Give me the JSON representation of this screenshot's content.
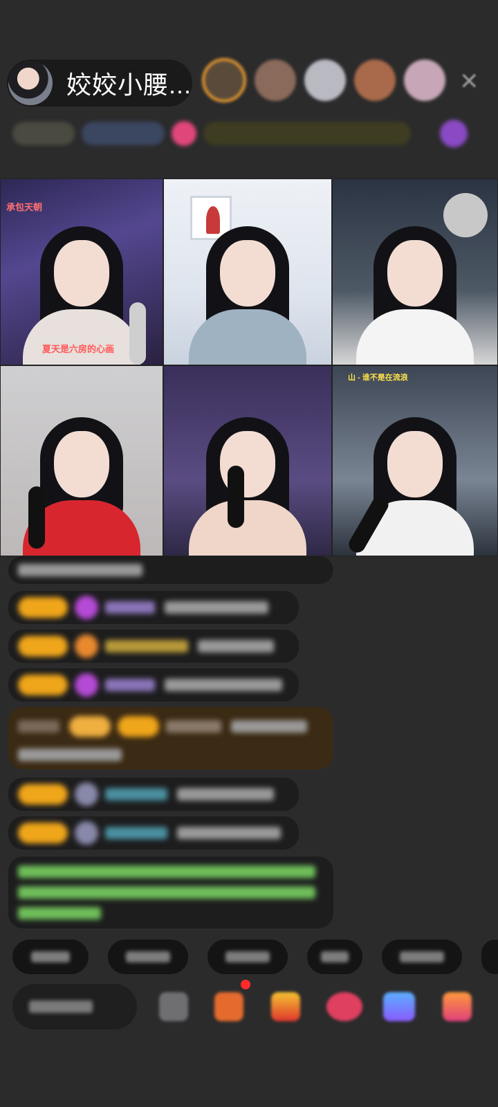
{
  "header": {
    "host_name": "姣姣小腰...",
    "viewers": [
      "viewer-1",
      "viewer-2",
      "viewer-3",
      "viewer-4",
      "viewer-5"
    ],
    "close_icon": "close-icon"
  },
  "video_grid": {
    "tiles": [
      {
        "caption_bottom": "夏天是六房的心画",
        "caption_top": "承包天朝"
      },
      {
        "caption_bottom": "",
        "caption_top": ""
      },
      {
        "caption_bottom": "",
        "caption_top": ""
      },
      {
        "caption_bottom": "",
        "caption_top": ""
      },
      {
        "caption_bottom": "",
        "caption_top": ""
      },
      {
        "caption_bottom": "",
        "caption_top": "山 - 谁不是在流浪"
      }
    ]
  },
  "colors": {
    "background": "#2b2b2c",
    "level_badge": "#f0a61a",
    "highlight_message": "#3b2a14",
    "green_text": "#6fbf5a"
  }
}
